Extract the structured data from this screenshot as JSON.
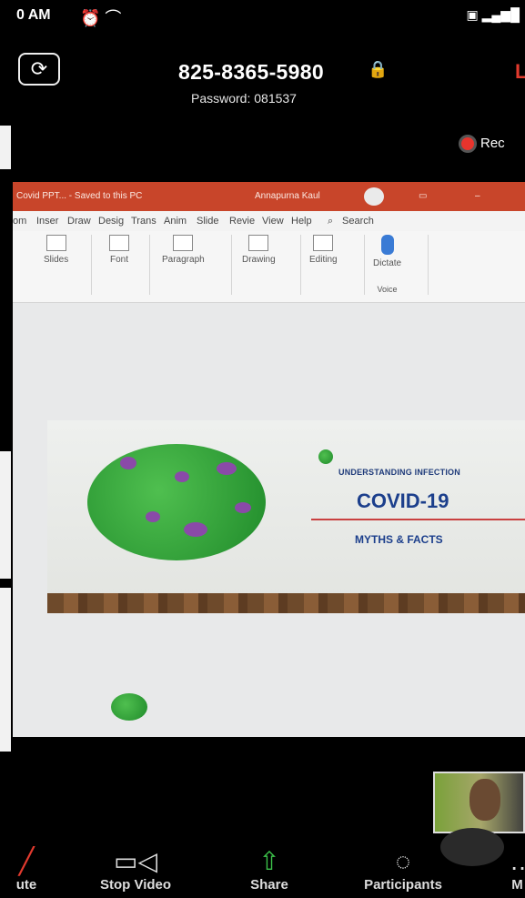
{
  "status_bar": {
    "time": "0 AM"
  },
  "meeting": {
    "id": "825-8365-5980",
    "password": "Password: 081537",
    "leave_label": "L",
    "record_label": "Rec"
  },
  "powerpoint": {
    "doc_title": "Covid PPT... - Saved to this PC",
    "user": "Annapurna Kaul",
    "tabs": [
      "om",
      "Inser",
      "Draw",
      "Desig",
      "Trans",
      "Anim",
      "Slide",
      "Revie",
      "View",
      "Help"
    ],
    "search_label": "Search",
    "ribbon_groups": [
      "Slides",
      "Font",
      "Paragraph",
      "Drawing",
      "Editing",
      "Dictate"
    ],
    "voice_label": "Voice"
  },
  "slide": {
    "kicker": "UNDERSTANDING INFECTION",
    "title": "COVID-19",
    "subtitle": "MYTHS & FACTS"
  },
  "toolbar": {
    "mute_label": "ute",
    "video_label": "Stop Video",
    "share_label": "Share",
    "participants_label": "Participants",
    "more_label": "M"
  },
  "colors": {
    "leave": "#e23a2e",
    "share_icon": "#3cc24a",
    "ppt_titlebar": "#c8452a",
    "slide_title": "#1c3f8c"
  }
}
